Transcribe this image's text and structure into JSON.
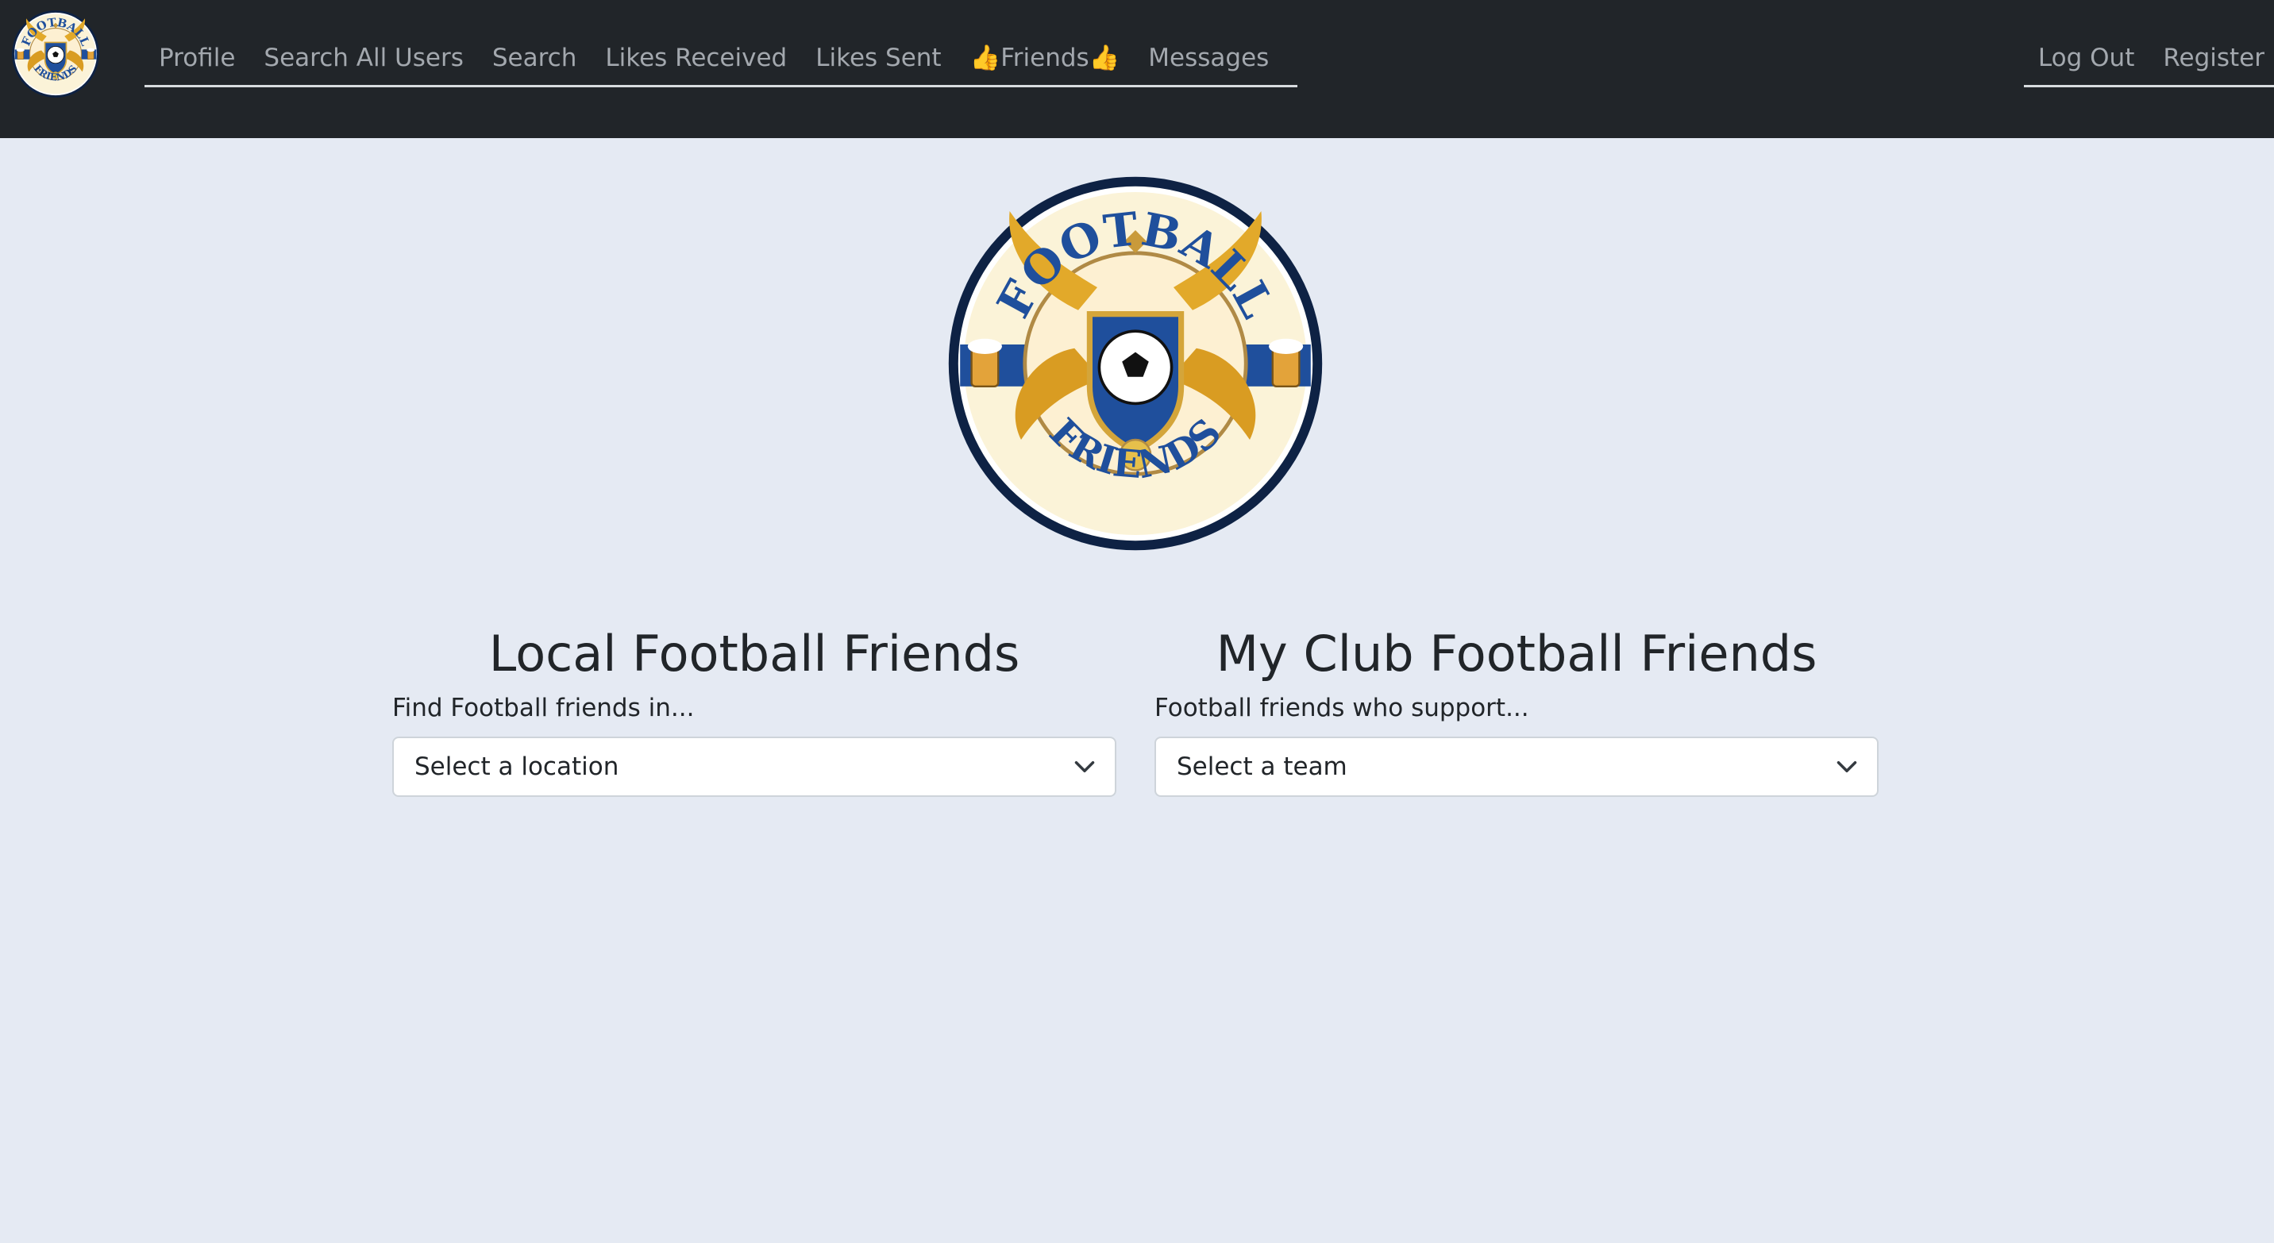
{
  "nav": {
    "logo_top_text": "FOOTBALL",
    "logo_bottom_text": "FRIENDS",
    "links": [
      "Profile",
      "Search All Users",
      "Search",
      "Likes Received",
      "Likes Sent",
      "👍Friends👍",
      "Messages"
    ],
    "right_links": [
      "Log Out",
      "Register"
    ]
  },
  "hero": {
    "logo_top_text": "FOOTBALL",
    "logo_bottom_text": "FRIENDS"
  },
  "local": {
    "title": "Local Football Friends",
    "label": "Find Football friends in...",
    "select_value": "Select a location"
  },
  "club": {
    "title": "My Club Football Friends",
    "label": "Football friends who support...",
    "select_value": "Select a team"
  },
  "colors": {
    "navbar": "#212529",
    "page_background": "#e5eaf3",
    "logo_navy": "#0e2244",
    "logo_blue": "#1f4f9c",
    "logo_gold": "#e2a92a",
    "logo_cream": "#fbf3d8"
  }
}
